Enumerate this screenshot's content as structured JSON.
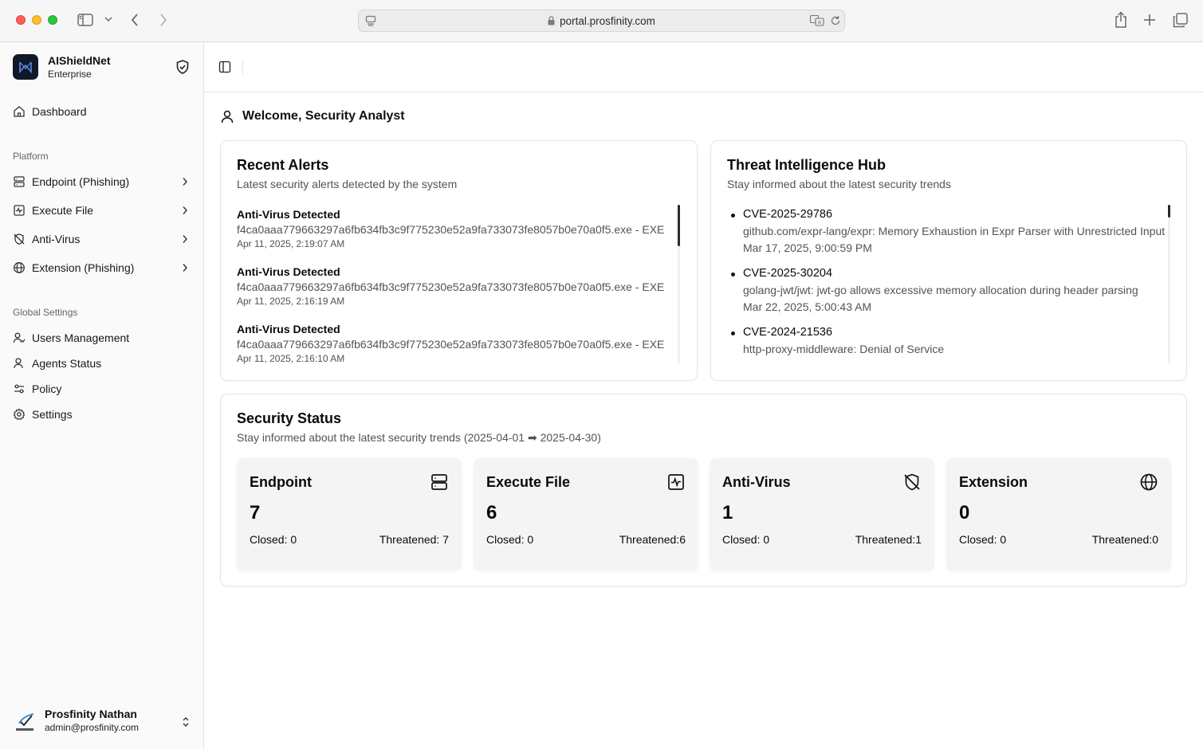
{
  "browser": {
    "url": "portal.prosfinity.com"
  },
  "sidebar": {
    "brand": {
      "name": "AIShieldNet",
      "subtitle": "Enterprise"
    },
    "dashboard_label": "Dashboard",
    "platform_label": "Platform",
    "platform_items": [
      {
        "label": "Endpoint (Phishing)",
        "icon": "server-icon"
      },
      {
        "label": "Execute File",
        "icon": "activity-icon"
      },
      {
        "label": "Anti-Virus",
        "icon": "shield-off-icon"
      },
      {
        "label": "Extension (Phishing)",
        "icon": "globe-icon"
      }
    ],
    "global_label": "Global Settings",
    "global_items": [
      {
        "label": "Users Management",
        "icon": "users-icon"
      },
      {
        "label": "Agents Status",
        "icon": "user-icon"
      },
      {
        "label": "Policy",
        "icon": "sliders-icon"
      },
      {
        "label": "Settings",
        "icon": "gear-icon"
      }
    ],
    "user": {
      "name": "Prosfinity Nathan",
      "email": "admin@prosfinity.com"
    }
  },
  "main": {
    "welcome": "Welcome, Security Analyst",
    "recent_alerts": {
      "title": "Recent Alerts",
      "description": "Latest security alerts detected by the system",
      "items": [
        {
          "title": "Anti-Virus Detected",
          "detail": "f4ca0aaa779663297a6fb634fb3c9f775230e52a9fa733073fe8057b0e70a0f5.exe - EXE",
          "time": "Apr 11, 2025, 2:19:07 AM"
        },
        {
          "title": "Anti-Virus Detected",
          "detail": "f4ca0aaa779663297a6fb634fb3c9f775230e52a9fa733073fe8057b0e70a0f5.exe - EXE",
          "time": "Apr 11, 2025, 2:16:19 AM"
        },
        {
          "title": "Anti-Virus Detected",
          "detail": "f4ca0aaa779663297a6fb634fb3c9f775230e52a9fa733073fe8057b0e70a0f5.exe - EXE",
          "time": "Apr 11, 2025, 2:16:10 AM"
        }
      ]
    },
    "threat_hub": {
      "title": "Threat Intelligence Hub",
      "description": "Stay informed about the latest security trends",
      "items": [
        {
          "id": "CVE-2025-29786",
          "text": "github.com/expr-lang/expr: Memory Exhaustion in Expr Parser with Unrestricted Input",
          "date": "Mar 17, 2025, 9:00:59 PM"
        },
        {
          "id": "CVE-2025-30204",
          "text": "golang-jwt/jwt: jwt-go allows excessive memory allocation during header parsing",
          "date": "Mar 22, 2025, 5:00:43 AM"
        },
        {
          "id": "CVE-2024-21536",
          "text": "http-proxy-middleware: Denial of Service",
          "date": ""
        }
      ]
    },
    "security_status": {
      "title": "Security Status",
      "description": "Stay informed about the latest security trends (2025-04-01 ➡ 2025-04-30)",
      "cards": [
        {
          "title": "Endpoint",
          "icon": "server-icon",
          "value": "7",
          "closed": "Closed: 0",
          "threatened": "Threatened: 7"
        },
        {
          "title": "Execute File",
          "icon": "activity-square-icon",
          "value": "6",
          "closed": "Closed: 0",
          "threatened": "Threatened:6"
        },
        {
          "title": "Anti-Virus",
          "icon": "shield-off-icon",
          "value": "1",
          "closed": "Closed: 0",
          "threatened": "Threatened:1"
        },
        {
          "title": "Extension",
          "icon": "globe-icon",
          "value": "0",
          "closed": "Closed: 0",
          "threatened": "Threatened:0"
        }
      ]
    }
  }
}
